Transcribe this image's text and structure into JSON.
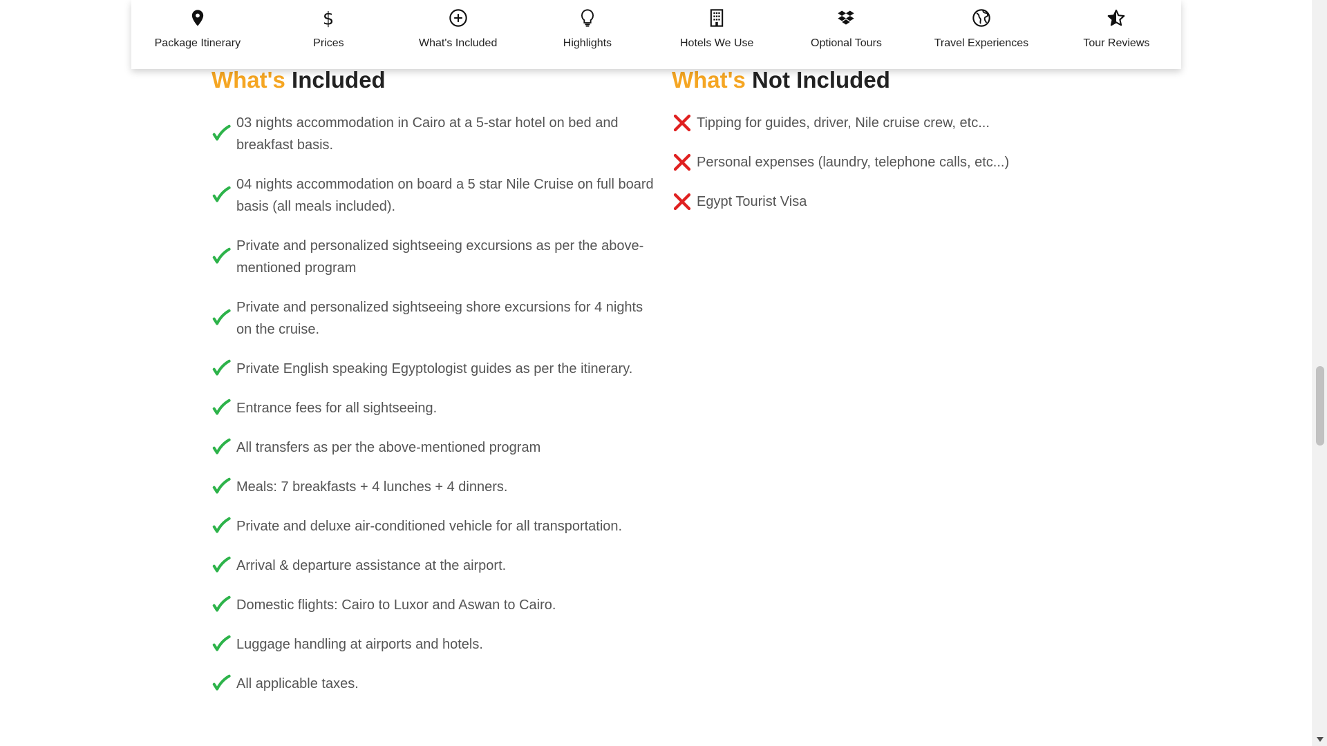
{
  "nav": {
    "items": [
      {
        "label": "Package Itinerary",
        "icon": "map-pin-icon"
      },
      {
        "label": "Prices",
        "icon": "dollar-icon"
      },
      {
        "label": "What's Included",
        "icon": "plus-circle-icon"
      },
      {
        "label": "Highlights",
        "icon": "lightbulb-icon"
      },
      {
        "label": "Hotels We Use",
        "icon": "building-icon"
      },
      {
        "label": "Optional Tours",
        "icon": "dropbox-icon"
      },
      {
        "label": "Travel Experiences",
        "icon": "globe-icon"
      },
      {
        "label": "Tour Reviews",
        "icon": "star-icon"
      }
    ]
  },
  "included": {
    "title_accent": "What's",
    "title_rest": " Included",
    "items": [
      "03 nights accommodation in Cairo at a 5-star hotel on bed and breakfast basis.",
      "04 nights accommodation on board a 5 star Nile Cruise on full board basis (all meals included).",
      "Private and personalized sightseeing excursions as per the above-mentioned program",
      "Private and personalized sightseeing shore excursions for 4 nights on the cruise.",
      "Private English speaking Egyptologist guides as per the itinerary.",
      "Entrance fees for all sightseeing.",
      "All transfers as per the above-mentioned program",
      "Meals: 7 breakfasts + 4 lunches + 4 dinners.",
      "Private and deluxe air-conditioned vehicle for all transportation.",
      "Arrival & departure assistance at the airport.",
      "Domestic flights: Cairo to Luxor and Aswan to Cairo.",
      "Luggage handling at airports and hotels.",
      "All applicable taxes."
    ]
  },
  "not_included": {
    "title_accent": "What's",
    "title_rest": " Not Included",
    "items": [
      "Tipping for guides, driver, Nile cruise crew, etc...",
      "Personal expenses (laundry, telephone calls, etc...)",
      "Egypt Tourist Visa"
    ]
  },
  "colors": {
    "accent": "#f5a623",
    "check": "#2db34a",
    "cross": "#e02020",
    "text": "#555555",
    "heading": "#222222"
  }
}
